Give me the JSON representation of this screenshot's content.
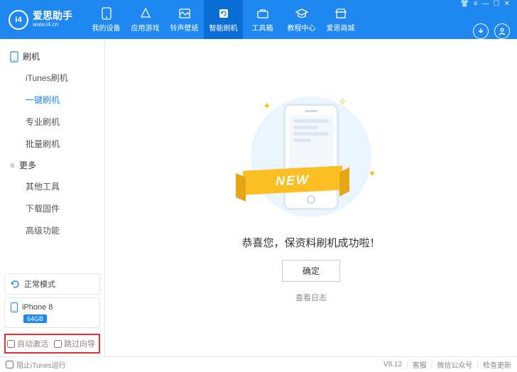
{
  "logo": {
    "title": "爱思助手",
    "subtitle": "www.i4.cn",
    "mark": "i4"
  },
  "nav": {
    "items": [
      {
        "label": "我的设备"
      },
      {
        "label": "应用游戏"
      },
      {
        "label": "铃声壁纸"
      },
      {
        "label": "智能刷机"
      },
      {
        "label": "工具箱"
      },
      {
        "label": "教程中心"
      },
      {
        "label": "爱思商城"
      }
    ]
  },
  "sidebar": {
    "group1": "刷机",
    "items1": [
      {
        "label": "iTunes刷机"
      },
      {
        "label": "一键刷机"
      },
      {
        "label": "专业刷机"
      },
      {
        "label": "批量刷机"
      }
    ],
    "group2": "更多",
    "items2": [
      {
        "label": "其他工具"
      },
      {
        "label": "下载固件"
      },
      {
        "label": "高级功能"
      }
    ],
    "status": "正常模式",
    "device": {
      "name": "iPhone 8",
      "storage": "64GB"
    },
    "opt1": "自动激活",
    "opt2": "跳过向导"
  },
  "main": {
    "ribbon": "NEW",
    "message": "恭喜您，保资料刷机成功啦！",
    "ok": "确定",
    "log": "查看日志"
  },
  "footer": {
    "prevent": "阻止iTunes运行",
    "version": "V8.12",
    "support": "客服",
    "wechat": "微信公众号",
    "update": "检查更新"
  }
}
